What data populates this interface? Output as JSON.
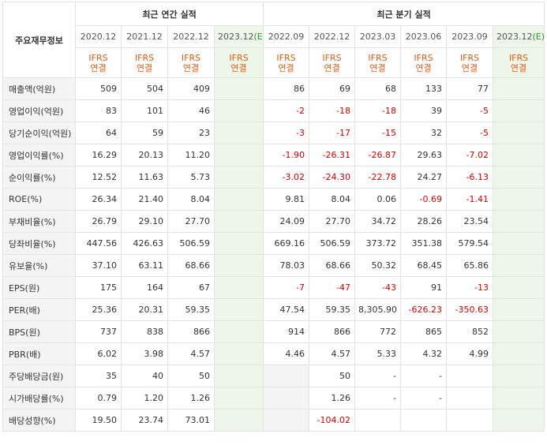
{
  "header": {
    "corner_label": "주요재무정보",
    "annual_title": "최근 연간 실적",
    "quarterly_title": "최근 분기 실적",
    "annual_periods": [
      "2020.12",
      "2021.12",
      "2022.12",
      "2023.12"
    ],
    "annual_estimate_mark": "(E)",
    "quarterly_periods": [
      "2022.09",
      "2022.12",
      "2023.03",
      "2023.06",
      "2023.09",
      "2023.12"
    ],
    "quarterly_estimate_mark": "(E)",
    "ifrs_line1": "IFRS",
    "ifrs_line2": "연결"
  },
  "rows": [
    {
      "label": "매출액(억원)",
      "annual": [
        "509",
        "504",
        "409",
        ""
      ],
      "quarterly": [
        "86",
        "69",
        "68",
        "133",
        "77",
        ""
      ]
    },
    {
      "label": "영업이익(억원)",
      "annual": [
        "83",
        "101",
        "46",
        ""
      ],
      "quarterly": [
        "-2",
        "-18",
        "-18",
        "39",
        "-5",
        ""
      ]
    },
    {
      "label": "당기순이익(억원)",
      "annual": [
        "64",
        "59",
        "23",
        ""
      ],
      "quarterly": [
        "-3",
        "-17",
        "-15",
        "32",
        "-5",
        ""
      ]
    },
    {
      "label": "영업이익률(%)",
      "annual": [
        "16.29",
        "20.13",
        "11.20",
        ""
      ],
      "quarterly": [
        "-1.90",
        "-26.31",
        "-26.87",
        "29.63",
        "-7.02",
        ""
      ]
    },
    {
      "label": "순이익률(%)",
      "annual": [
        "12.52",
        "11.63",
        "5.73",
        ""
      ],
      "quarterly": [
        "-3.02",
        "-24.30",
        "-22.78",
        "24.27",
        "-6.13",
        ""
      ]
    },
    {
      "label": "ROE(%)",
      "annual": [
        "26.34",
        "21.40",
        "8.04",
        ""
      ],
      "quarterly": [
        "9.81",
        "8.04",
        "0.06",
        "-0.69",
        "-1.41",
        ""
      ]
    },
    {
      "label": "부채비율(%)",
      "annual": [
        "26.79",
        "29.10",
        "27.70",
        ""
      ],
      "quarterly": [
        "24.09",
        "27.70",
        "34.72",
        "28.26",
        "23.54",
        ""
      ]
    },
    {
      "label": "당좌비율(%)",
      "annual": [
        "447.56",
        "426.63",
        "506.59",
        ""
      ],
      "quarterly": [
        "669.16",
        "506.59",
        "373.72",
        "351.38",
        "579.54",
        ""
      ]
    },
    {
      "label": "유보율(%)",
      "annual": [
        "37.10",
        "63.11",
        "68.66",
        ""
      ],
      "quarterly": [
        "78.03",
        "68.66",
        "50.32",
        "68.45",
        "65.86",
        ""
      ]
    },
    {
      "label": "EPS(원)",
      "annual": [
        "175",
        "164",
        "67",
        ""
      ],
      "quarterly": [
        "-7",
        "-47",
        "-43",
        "91",
        "-13",
        ""
      ]
    },
    {
      "label": "PER(배)",
      "annual": [
        "25.36",
        "20.31",
        "59.35",
        ""
      ],
      "quarterly": [
        "47.54",
        "59.35",
        "8,305.90",
        "-626.23",
        "-350.63",
        ""
      ]
    },
    {
      "label": "BPS(원)",
      "annual": [
        "737",
        "838",
        "866",
        ""
      ],
      "quarterly": [
        "914",
        "866",
        "772",
        "865",
        "852",
        ""
      ]
    },
    {
      "label": "PBR(배)",
      "annual": [
        "6.02",
        "3.98",
        "4.57",
        ""
      ],
      "quarterly": [
        "4.46",
        "4.57",
        "5.33",
        "4.32",
        "4.99",
        ""
      ]
    },
    {
      "label": "주당배당금(원)",
      "annual": [
        "35",
        "40",
        "50",
        ""
      ],
      "quarterly": [
        null,
        "50",
        "-",
        "-",
        "",
        ""
      ]
    },
    {
      "label": "시가배당률(%)",
      "annual": [
        "0.79",
        "1.20",
        "1.26",
        ""
      ],
      "quarterly": [
        null,
        "1.26",
        "-",
        "-",
        "",
        ""
      ]
    },
    {
      "label": "배당성향(%)",
      "annual": [
        "19.50",
        "23.74",
        "73.01",
        ""
      ],
      "quarterly": [
        null,
        "-104.02",
        "",
        "",
        "",
        ""
      ]
    }
  ],
  "group_starts": [
    0,
    3,
    6,
    9,
    13
  ],
  "colors": {
    "negative": "#e00000",
    "ifrs": "#e85a12",
    "estimate_bg": "#eef6ea",
    "estimate_mark": "#2c9c2c"
  }
}
